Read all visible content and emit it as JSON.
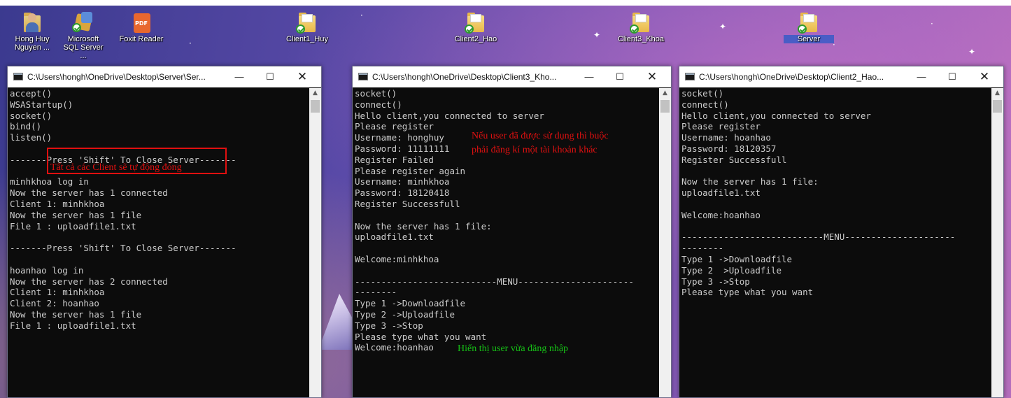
{
  "desktop": {
    "icons": [
      {
        "label": "Hong Huy Nguyen ...",
        "icon": "user-folder-icon"
      },
      {
        "label": "Microsoft SQL Server ...",
        "icon": "sql-server-icon"
      },
      {
        "label": "Foxit Reader",
        "icon": "foxit-reader-icon"
      },
      {
        "label": "Client1_Huy",
        "icon": "exe-folder-icon"
      },
      {
        "label": "Client2_Hao",
        "icon": "exe-folder-icon"
      },
      {
        "label": "Client3_Khoa",
        "icon": "exe-folder-icon"
      },
      {
        "label": "Server",
        "icon": "exe-folder-icon"
      }
    ]
  },
  "windows": [
    {
      "title": "C:\\Users\\hongh\\OneDrive\\Desktop\\Server\\Ser...",
      "controls": {
        "minimize": "—",
        "maximize": "☐",
        "close": "✕"
      },
      "lines": [
        "accept()",
        "WSAStartup()",
        "socket()",
        "bind()",
        "listen()",
        "",
        "-------Press 'Shift' To Close Server-------",
        "",
        "minhkhoa log in",
        "Now the server has 1 connected",
        "Client 1: minhkhoa",
        "Now the server has 1 file",
        "File 1 : uploadfile1.txt",
        "",
        "-------Press 'Shift' To Close Server-------",
        "",
        "hoanhao log in",
        "Now the server has 2 connected",
        "Client 1: minhkhoa",
        "Client 2: hoanhao",
        "Now the server has 1 file",
        "File 1 : uploadfile1.txt"
      ]
    },
    {
      "title": "C:\\Users\\hongh\\OneDrive\\Desktop\\Client3_Kho...",
      "controls": {
        "minimize": "—",
        "maximize": "☐",
        "close": "✕"
      },
      "lines": [
        "socket()",
        "connect()",
        "Hello client,you connected to server",
        "Please register",
        "Username: honghuy",
        "Password: 11111111",
        "Register Failed",
        "Please register again",
        "Username: minhkhoa",
        "Password: 18120418",
        "Register Successfull",
        "",
        "Now the server has 1 file:",
        "uploadfile1.txt",
        "",
        "Welcome:minhkhoa",
        "",
        "---------------------------MENU----------------------",
        "--------",
        "Type 1 ->Downloadfile",
        "Type 2 ->Uploadfile",
        "Type 3 ->Stop",
        "Please type what you want",
        "Welcome:hoanhao"
      ]
    },
    {
      "title": "C:\\Users\\hongh\\OneDrive\\Desktop\\Client2_Hao...",
      "controls": {
        "minimize": "—",
        "maximize": "☐",
        "close": "✕"
      },
      "lines": [
        "socket()",
        "connect()",
        "Hello client,you connected to server",
        "Please register",
        "Username: hoanhao",
        "Password: 18120357",
        "Register Successfull",
        "",
        "Now the server has 1 file:",
        "uploadfile1.txt",
        "",
        "Welcome:hoanhao",
        "",
        "---------------------------MENU---------------------",
        "--------",
        "Type 1 ->Downloadfile",
        "Type 2  >Uploadfile",
        "Type 3 ->Stop",
        "Please type what you want"
      ]
    }
  ],
  "annotations": {
    "server_note": "Tất cả các Client sẽ tự động đóng",
    "register_note_1": "Nếu user đã được sử dụng thì buộc",
    "register_note_2": "phải đăng kí một tài khoản khác",
    "login_note": "Hiển thị user vừa đăng nhập"
  },
  "colors": {
    "annotation_red": "#e01010",
    "annotation_green": "#16c016",
    "console_bg": "#0c0c0c",
    "console_text": "#cccccc"
  }
}
